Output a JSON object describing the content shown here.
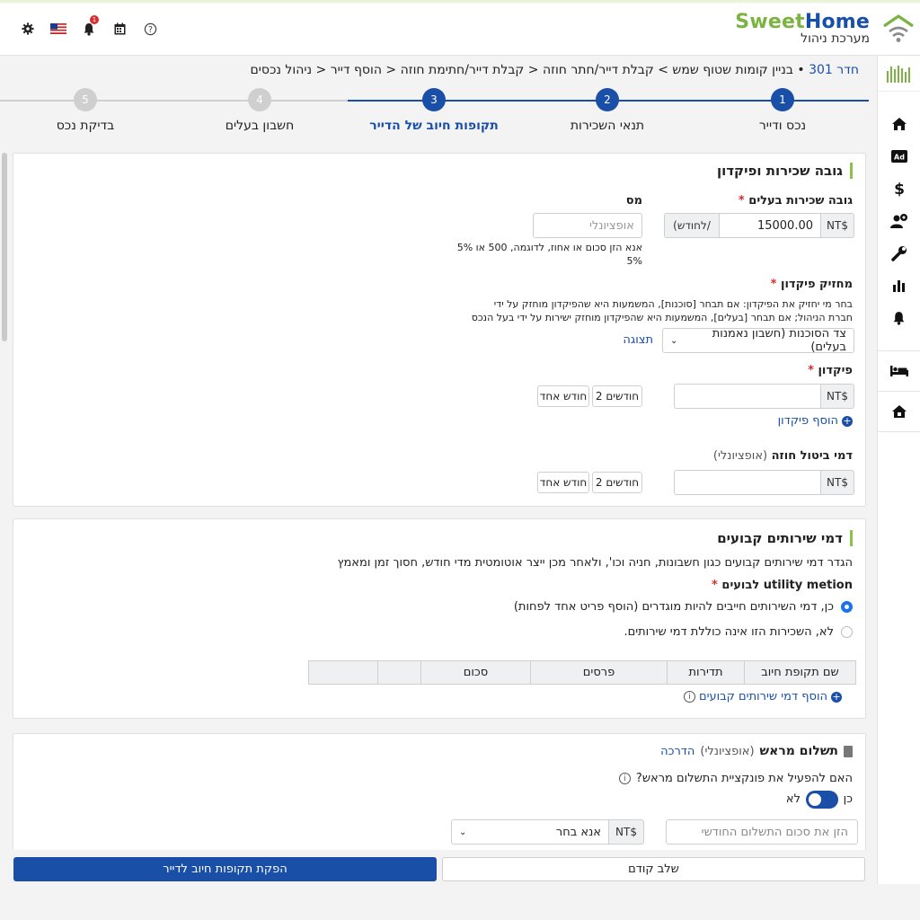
{
  "header": {
    "brand_sweet": "Sweet",
    "brand_home": "Home",
    "subtitle": "מערכת ניהול",
    "notification_count": "1",
    "icons": [
      "gear-icon",
      "us-flag-icon",
      "bell-icon",
      "calendar-icon",
      "help-icon"
    ]
  },
  "sidebar": {
    "items": [
      "home-icon",
      "ad-icon",
      "dollar-icon",
      "users-gear-icon",
      "wrench-icon",
      "bar-chart-icon",
      "bell-icon",
      "bed-icon",
      "house-icon"
    ]
  },
  "breadcrumb": {
    "room": "חדר 301",
    "path": "• בניין קומות שטוף שמש > קבלת דייר/חתר חוזה < קבלת דייר/חתימת חוזה < הוסף דייר < ניהול נכסים"
  },
  "stepper": {
    "steps": [
      {
        "num": "1",
        "label": "נכס ודייר",
        "state": "done"
      },
      {
        "num": "2",
        "label": "תנאי השכירות",
        "state": "done"
      },
      {
        "num": "3",
        "label": "תקופות חיוב של הדייר",
        "state": "active"
      },
      {
        "num": "4",
        "label": "חשבון בעלים",
        "state": "todo"
      },
      {
        "num": "5",
        "label": "בדיקת נכס",
        "state": "todo"
      }
    ],
    "colors": {
      "active": "#1a4fa8",
      "todo": "#cfcfcf"
    }
  },
  "rent_card": {
    "title": "גובה שכירות ופיקדון",
    "rent_label": "גובה שכירות בעלים",
    "req": "*",
    "currency": "NT$",
    "rent_value": "15000.00",
    "per_month": "(לחודש/",
    "tax_label": "מס",
    "tax_placeholder": "אופציונלי",
    "tax_hint_1": "אנא הזן סכום או אחוז, לדוגמה, 500 או 5%",
    "tax_hint_2": "5%",
    "holder_label": "מחזיק פיקדון",
    "holder_desc_1": "בחר מי יחזיק את הפיקדון: אם תבחר [סוכנות], המשמעות היא שהפיקדון מוחזק על ידי",
    "holder_desc_2": "חברת הניהול; אם תבחר [בעלים], המשמעות היא שהפיקדון מוחזק ישירות על ידי בעל הנכס",
    "holder_value": "צד הסוכנות (חשבון נאמנות בעלים)",
    "preview_link": "תצוגה",
    "deposit_label": "פיקדון",
    "two_months": "2 חודשים",
    "one_month": "חודש אחד",
    "add_deposit": "הוסף פיקדון",
    "cancel_fee_label": "דמי ביטול חוזה",
    "optional": "(אופציונלי)"
  },
  "services_card": {
    "title": "דמי שירותים קבועים",
    "desc": "הגדר דמי שירותים קבועים כגון חשבונות, חניה וכו', ולאחר מכן ייצר אוטומטית מדי חודש, חסוך זמן ומאמץ",
    "utility_label": "utility metion לבועים",
    "req": "*",
    "option_yes": "כן, דמי השירותים חייבים להיות  מוגדרים (הוסף פריט אחד לפחות)",
    "option_no": "לא, השכירות הזו אינה כוללת דמי שירותים.",
    "table_headers": [
      "שם תקופת חיוב",
      "תדירות",
      "פרסים",
      "סכום",
      "",
      ""
    ],
    "add_link": "הוסף דמי שירותים קבועים"
  },
  "prepay_card": {
    "title": "תשלום מראש",
    "optional": "(אופציונלי)",
    "guide": "הדרכה",
    "question": "האם להפעיל את פונקציית התשלום מראש?",
    "yes": "כן",
    "no": "לא",
    "amount_placeholder": "הזן את סכום התשלום החודשי",
    "currency": "NT$",
    "select_value": "אנא בחר"
  },
  "footer": {
    "prev": "שלב קודם",
    "next": "הפקת תקופות חיוב לדייר"
  }
}
